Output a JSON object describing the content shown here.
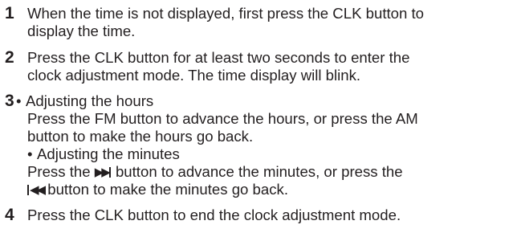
{
  "steps": [
    {
      "number": "1",
      "lines": [
        "When the time is not displayed, first press the CLK button to",
        "display the time."
      ]
    },
    {
      "number": "2",
      "lines": [
        "Press the CLK button for at least two seconds to enter the",
        "clock adjustment mode. The time display will blink."
      ]
    },
    {
      "number": "3",
      "bullets": [
        {
          "heading": "Adjusting the hours",
          "lines": [
            "Press the FM button to advance the hours, or press the AM",
            "button to make the hours go back."
          ]
        },
        {
          "heading": "Adjusting the minutes",
          "line1_before": "Press the ",
          "line1_after": " button to advance the minutes, or press the",
          "line2_after": " button to make the minutes go back.",
          "next_icon": "skip-next-icon",
          "prev_icon": "skip-previous-icon"
        }
      ]
    },
    {
      "number": "4",
      "lines": [
        "Press the CLK button to end the clock adjustment mode."
      ]
    }
  ]
}
